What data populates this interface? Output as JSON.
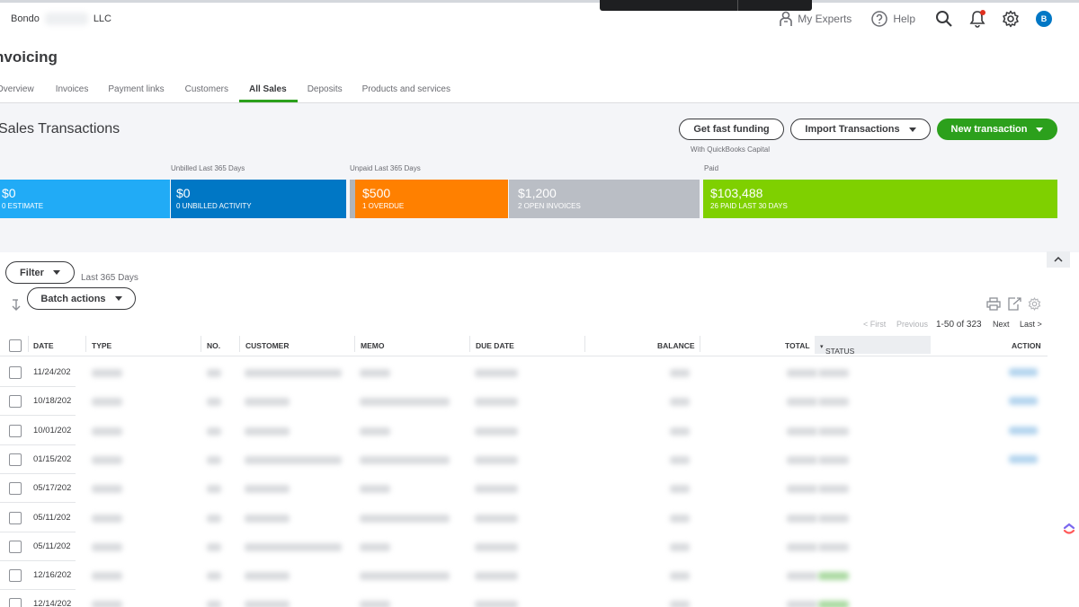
{
  "header": {
    "company_prefix": "Bondo",
    "company_suffix": "LLC",
    "my_experts": "My Experts",
    "help": "Help",
    "avatar_initial": "B"
  },
  "page": {
    "title": "nvoicing"
  },
  "tabs": [
    {
      "label": "Overview"
    },
    {
      "label": "Invoices"
    },
    {
      "label": "Payment links"
    },
    {
      "label": "Customers"
    },
    {
      "label": "All Sales"
    },
    {
      "label": "Deposits"
    },
    {
      "label": "Products and services"
    }
  ],
  "summary": {
    "section_title": "Sales Transactions",
    "get_fast_funding": "Get fast funding",
    "funding_note": "With QuickBooks Capital",
    "import_transactions": "Import Transactions",
    "new_transaction": "New transaction",
    "label_unbilled": "Unbilled Last 365 Days",
    "label_unpaid": "Unpaid Last 365 Days",
    "label_paid": "Paid",
    "blocks": [
      {
        "amount": "$0",
        "caption": "0 ESTIMATE",
        "color": "#21abf6"
      },
      {
        "amount": "$0",
        "caption": "0 UNBILLED ACTIVITY",
        "color": "#0077c5"
      },
      {
        "amount": "$500",
        "caption": "1 OVERDUE",
        "color": "#ff8000"
      },
      {
        "amount": "$1,200",
        "caption": "2 OPEN INVOICES",
        "color": "#babec5"
      },
      {
        "amount": "$103,488",
        "caption": "26 PAID LAST 30 DAYS",
        "color": "#7fd000"
      }
    ]
  },
  "filters": {
    "filter_label": "Filter",
    "date_range": "Last 365 Days",
    "batch_actions": "Batch actions"
  },
  "pagination": {
    "first": "< First",
    "previous": "Previous",
    "range": "1-50 of 323",
    "next": "Next",
    "last": "Last >"
  },
  "table": {
    "columns": [
      "DATE",
      "TYPE",
      "NO.",
      "CUSTOMER",
      "MEMO",
      "DUE DATE",
      "BALANCE",
      "TOTAL",
      "STATUS",
      "ACTION"
    ],
    "rows": [
      {
        "date": "11/24/202"
      },
      {
        "date": "10/18/202"
      },
      {
        "date": "10/01/202"
      },
      {
        "date": "01/15/202"
      },
      {
        "date": "05/17/202"
      },
      {
        "date": "05/11/202"
      },
      {
        "date": "05/11/202"
      },
      {
        "date": "12/16/202"
      },
      {
        "date": "12/14/202"
      }
    ]
  }
}
